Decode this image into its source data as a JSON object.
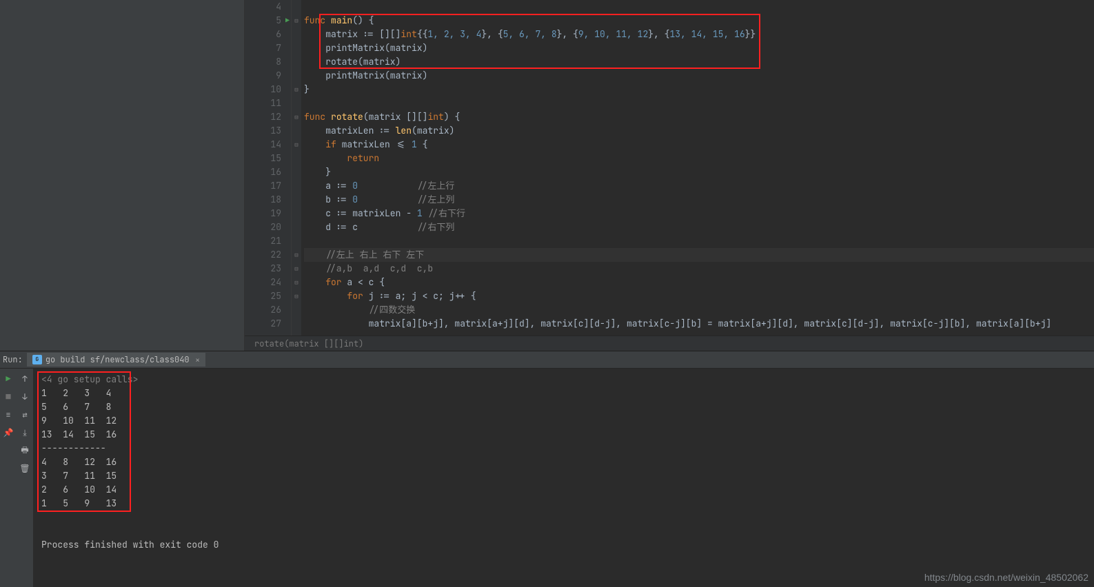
{
  "editor": {
    "lines": [
      4,
      5,
      6,
      7,
      8,
      9,
      10,
      11,
      12,
      13,
      14,
      15,
      16,
      17,
      18,
      19,
      20,
      21,
      22,
      23,
      24,
      25,
      26,
      27
    ],
    "breadcrumb": "rotate(matrix [][]int)",
    "code": {
      "l4": "",
      "l5": {
        "kw1": "func ",
        "fn": "main",
        "rest": "() {"
      },
      "l6": {
        "pre": "    matrix := [][]",
        "typ": "int",
        "mid": "{{",
        "n": "1, 2, 3, 4",
        "c1": "}, {",
        "n2": "5, 6, 7, 8",
        "c2": "}, {",
        "n3": "9, 10, 11, 12",
        "c3": "}, {",
        "n4": "13, 14, 15, 16",
        "end": "}}"
      },
      "l7": "    printMatrix(matrix)",
      "l8": "    rotate(matrix)",
      "l9": "    printMatrix(matrix)",
      "l10": "}",
      "l11": "",
      "l12": {
        "kw1": "func ",
        "fn": "rotate",
        "rest": "(matrix [][]",
        "typ": "int",
        "rest2": ") {"
      },
      "l13": {
        "pre": "    matrixLen := ",
        "fn": "len",
        "rest": "(matrix)"
      },
      "l14": {
        "pre": "    ",
        "kw": "if ",
        "rest": "matrixLen <= ",
        "n": "1",
        "rest2": " {"
      },
      "l15": {
        "pre": "        ",
        "kw": "return"
      },
      "l16": "    }",
      "l17": {
        "pre": "    a := ",
        "n": "0",
        "ws": "           ",
        "cm": "//左上行"
      },
      "l18": {
        "pre": "    b := ",
        "n": "0",
        "ws": "           ",
        "cm": "//左上列"
      },
      "l19": {
        "pre": "    c := matrixLen - ",
        "n": "1",
        "ws": " ",
        "cm": "//右下行"
      },
      "l20": {
        "pre": "    d := c",
        "ws": "           ",
        "cm": "//右下列"
      },
      "l21": "",
      "l22": {
        "pre": "    ",
        "cm": "//左上 右上 右下 左下"
      },
      "l23": {
        "pre": "    ",
        "cm": "//a,b  a,d  c,d  c,b"
      },
      "l24": {
        "pre": "    ",
        "kw": "for ",
        "rest": "a < c {"
      },
      "l25": {
        "pre": "        ",
        "kw": "for ",
        "rest": "j := a; j < c; j++ {"
      },
      "l26": {
        "pre": "            ",
        "cm": "//四数交换"
      },
      "l27": "            matrix[a][b+j], matrix[a+j][d], matrix[c][d-j], matrix[c-j][b] = matrix[a+j][d], matrix[c][d-j], matrix[c-j][b], matrix[a][b+j]"
    }
  },
  "run": {
    "panel_label": "Run:",
    "tab_label": "go build sf/newclass/class040",
    "output": {
      "setup": "<4 go setup calls>",
      "m1": [
        "1   2   3   4",
        "5   6   7   8",
        "9   10  11  12",
        "13  14  15  16"
      ],
      "sep": "------------",
      "m2": [
        "4   8   12  16",
        "3   7   11  15",
        "2   6   10  14",
        "1   5   9   13"
      ],
      "exit": "Process finished with exit code 0"
    }
  },
  "watermark": "https://blog.csdn.net/weixin_48502062",
  "chart_data": {
    "type": "table",
    "title": "4x4 matrix before and after rotate()",
    "before": [
      [
        1,
        2,
        3,
        4
      ],
      [
        5,
        6,
        7,
        8
      ],
      [
        9,
        10,
        11,
        12
      ],
      [
        13,
        14,
        15,
        16
      ]
    ],
    "after": [
      [
        4,
        8,
        12,
        16
      ],
      [
        3,
        7,
        11,
        15
      ],
      [
        2,
        6,
        10,
        14
      ],
      [
        1,
        5,
        9,
        13
      ]
    ]
  }
}
